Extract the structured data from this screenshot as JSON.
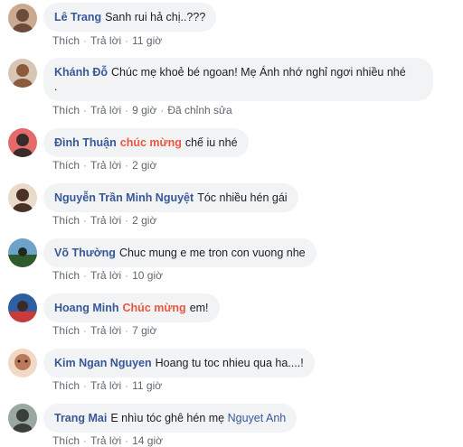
{
  "comments": [
    {
      "name": "Lê Trang",
      "text": "Sanh rui hả chị..???",
      "like": "Thích",
      "reply": "Trả lời",
      "time": "11 giờ",
      "avatar_colors": [
        "#c9a98f",
        "#6b4b3a"
      ]
    },
    {
      "name": "Khánh Đỗ",
      "text": "Chúc mẹ khoẻ bé ngoan! Mẹ Ánh nhớ nghỉ ngơi nhiều nhé",
      "text_line2": ".",
      "like": "Thích",
      "reply": "Trả lời",
      "time": "9 giờ",
      "edited": "Đã chỉnh sửa",
      "avatar_colors": [
        "#d8c6b4",
        "#8c5a3c"
      ]
    },
    {
      "name": "Đình Thuận",
      "tag": "chúc mừng",
      "text": "chế iu nhé",
      "like": "Thích",
      "reply": "Trả lời",
      "time": "2 giờ",
      "avatar_colors": [
        "#e56b6b",
        "#3a2a2a"
      ]
    },
    {
      "name": "Nguyễn Trần Minh Nguyệt",
      "text": "Tóc nhiều hén gái",
      "like": "Thích",
      "reply": "Trả lời",
      "time": "2 giờ",
      "avatar_colors": [
        "#eadbc8",
        "#4a3326"
      ]
    },
    {
      "name": "Võ Thường",
      "text": "Chuc mung e me tron con vuong nhe",
      "like": "Thích",
      "reply": "Trả lời",
      "time": "10 giờ",
      "avatar_colors": [
        "#6ea3c9",
        "#2f5a2c"
      ]
    },
    {
      "name": "Hoang Minh",
      "tag": "Chúc mừng",
      "text": "em!",
      "like": "Thích",
      "reply": "Trả lời",
      "time": "7 giờ",
      "avatar_colors": [
        "#2e5fa3",
        "#c93a3a"
      ]
    },
    {
      "name": "Kim Ngan Nguyen",
      "text": "Hoang tu toc nhieu qua ha....!",
      "like": "Thích",
      "reply": "Trả lời",
      "time": "11 giờ",
      "avatar_colors": [
        "#f1d9c6",
        "#b87a5a"
      ]
    },
    {
      "name": "Trang Mai",
      "text": "E nhìu tóc ghê hén mẹ",
      "mention": "Nguyet Anh",
      "like": "Thích",
      "reply": "Trả lời",
      "time": "14 giờ",
      "avatar_colors": [
        "#9aa8a0",
        "#3b3f3a"
      ]
    }
  ],
  "colors": {
    "bubble": "#f2f3f5",
    "name": "#385898",
    "tag": "#e9573e",
    "meta": "#606770"
  }
}
